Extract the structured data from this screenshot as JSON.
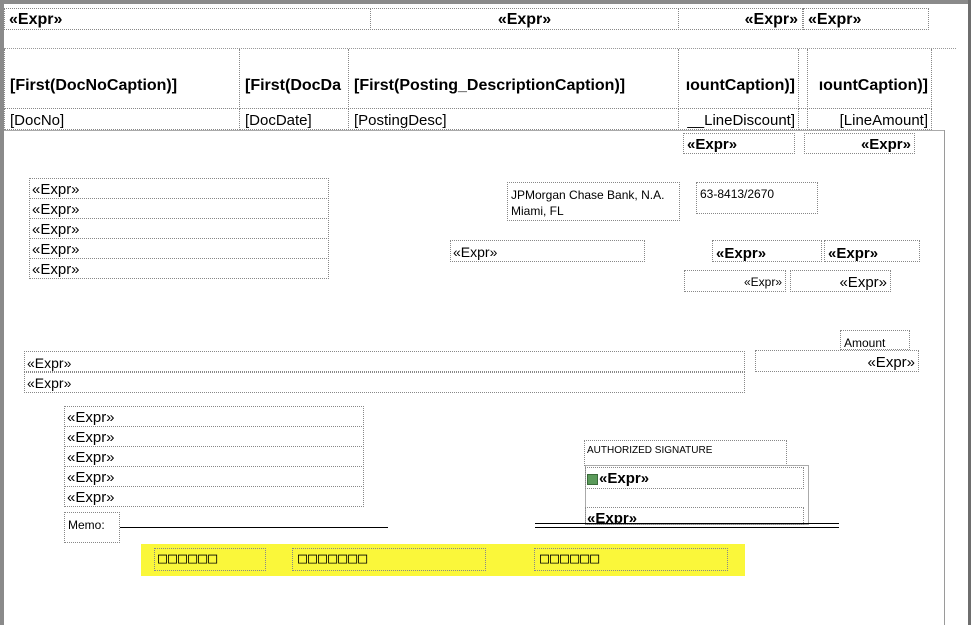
{
  "header": {
    "expr1": "«Expr»",
    "expr2": "«Expr»",
    "expr3": "«Expr»",
    "expr4": "«Expr»"
  },
  "columns": {
    "captions": [
      "[First(DocNoCaption)]",
      "[First(DocDa",
      "[First(Posting_DescriptionCaption)]",
      "ıountCaption)]",
      "ıountCaption)]"
    ],
    "values": [
      "[DocNo]",
      "[DocDate]",
      "[PostingDesc]",
      "__LineDiscount]",
      "[LineAmount]"
    ]
  },
  "totals": {
    "expr1": "«Expr»",
    "expr2": "«Expr»"
  },
  "address_block": [
    "«Expr»",
    "«Expr»",
    "«Expr»",
    "«Expr»",
    "«Expr»"
  ],
  "bank": {
    "line1": "JPMorgan Chase Bank, N.A.",
    "line2": "Miami, FL",
    "routing": "63-8413/2670"
  },
  "check_no": "«Expr»",
  "date_amount": {
    "a": "«Expr»",
    "b": "«Expr»",
    "c": "«Expr»",
    "d": "«Expr»"
  },
  "amount_label": "Amount",
  "amount_value": "«Expr»",
  "amount_words": [
    "«Expr»",
    "«Expr»"
  ],
  "payee_block": [
    "«Expr»",
    "«Expr»",
    "«Expr»",
    "«Expr»",
    "«Expr»"
  ],
  "memo_label": "Memo:",
  "signature": {
    "label": "AUTHORIZED SIGNATURE",
    "expr1": "«Expr»",
    "expr2": "«Expr»"
  },
  "micr": [
    "□□□□□□",
    "□□□□□□□",
    "□□□□□□"
  ],
  "colors": {
    "highlight": "#faf73a",
    "border": "#888888"
  }
}
